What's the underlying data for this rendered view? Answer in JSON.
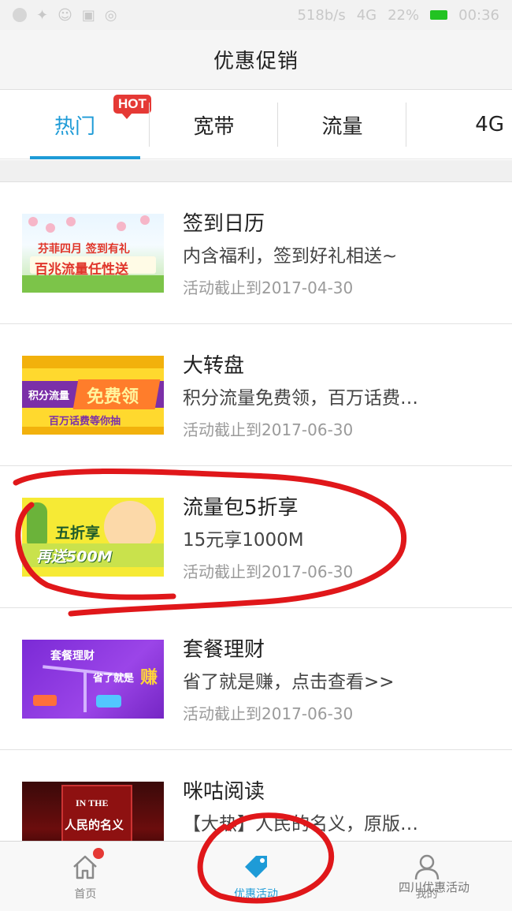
{
  "status_bar": {
    "left": [
      "●",
      "✦",
      "☺",
      "▣",
      "◎"
    ],
    "speed": "518b/s",
    "signal": "4G",
    "battery": "22%",
    "time": "00:36"
  },
  "header": {
    "title": "优惠促销"
  },
  "tabs": [
    {
      "label": "热门",
      "badge": "HOT",
      "active": true
    },
    {
      "label": "宽带",
      "active": false
    },
    {
      "label": "流量",
      "active": false
    },
    {
      "label": "4G",
      "active": false
    }
  ],
  "promotions": [
    {
      "title": "签到日历",
      "description": "内含福利，签到好礼相送~",
      "deadline": "活动截止到2017-04-30",
      "banner": {
        "line1": "芬菲四月 签到有礼",
        "line2": "百兆流量任性送"
      }
    },
    {
      "title": "大转盘",
      "description": "积分流量免费领，百万话费…",
      "deadline": "活动截止到2017-06-30",
      "banner": {
        "line1": "积分流量",
        "line2": "免费领",
        "line3": "百万话费等你抽"
      }
    },
    {
      "title": "流量包5折享",
      "description": "15元享1000M",
      "deadline": "活动截止到2017-06-30",
      "banner": {
        "line1": "五折享",
        "line2": "再送500M"
      }
    },
    {
      "title": "套餐理财",
      "description": "省了就是赚，点击查看>>",
      "deadline": "活动截止到2017-06-30",
      "banner": {
        "line1": "套餐理财",
        "line2": "省了就是",
        "line3": "赚"
      }
    },
    {
      "title": "咪咕阅读",
      "description": "【大热】人民的名义，原版…",
      "deadline": "",
      "banner": {
        "line1": "IN THE",
        "line2": "人民的名义"
      }
    }
  ],
  "bottom_nav": [
    {
      "label": "首页",
      "icon": "home-icon",
      "active": false,
      "dot": true
    },
    {
      "label": "优惠活动",
      "icon": "tag-icon",
      "active": true,
      "dot": false
    },
    {
      "label": "我的",
      "icon": "user-icon",
      "active": false,
      "dot": false
    }
  ],
  "watermark": "四川优惠活动",
  "colors": {
    "accent": "#1e9bd7",
    "hot_badge": "#e53935",
    "annotation": "#e0171a"
  }
}
